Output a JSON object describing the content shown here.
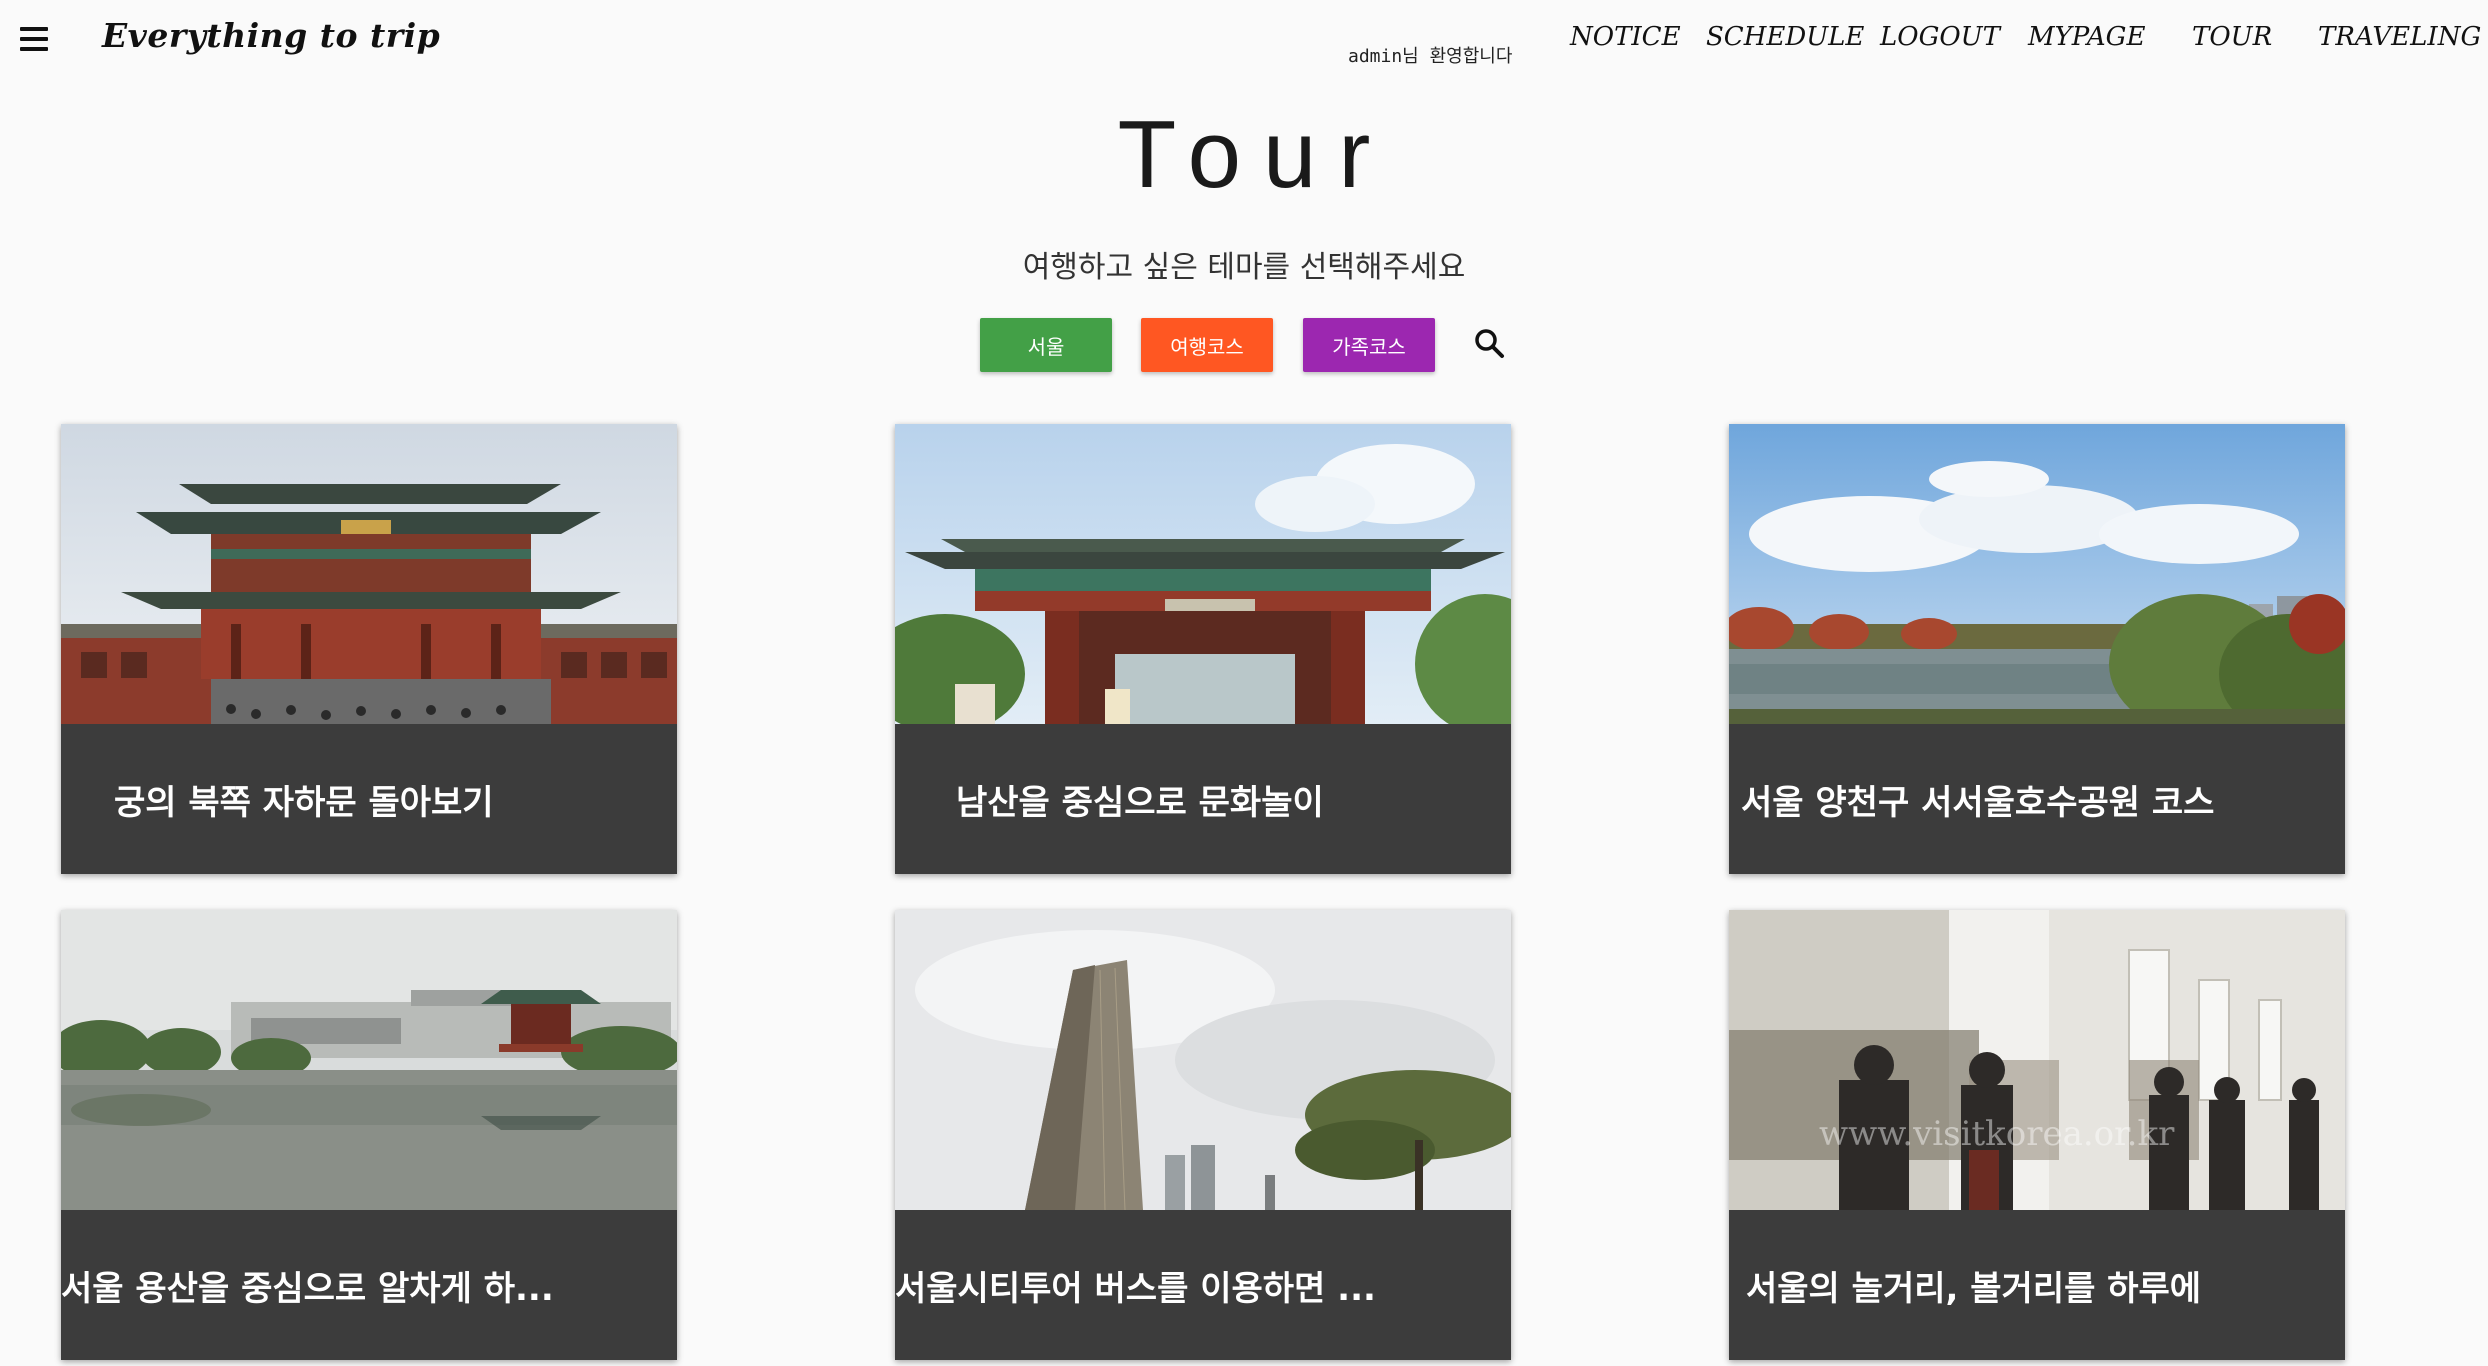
{
  "header": {
    "brand": "Everything to trip",
    "welcome": "admin님 환영합니다",
    "nav": [
      "NOTICE",
      "SCHEDULE",
      "LOGOUT",
      "MYPAGE",
      "TOUR",
      "TRAVELING"
    ]
  },
  "page": {
    "title": "Tour",
    "subtitle": "여행하고 싶은 테마를 선택해주세요"
  },
  "filters": [
    {
      "label": "서울",
      "color": "#43a047"
    },
    {
      "label": "여행코스",
      "color": "#ff5722"
    },
    {
      "label": "가족코스",
      "color": "#9c27b0"
    }
  ],
  "search": {
    "icon": "search-icon"
  },
  "cards": [
    {
      "title": "궁의 북쪽 자하문 돌아보기"
    },
    {
      "title": "남산을 중심으로 문화놀이"
    },
    {
      "title": "서울 양천구 서서울호수공원 코스"
    },
    {
      "title": "서울 용산을 중심으로 알차게 하..."
    },
    {
      "title": "서울시티투어 버스를 이용하면 ..."
    },
    {
      "title": "서울의 놀거리, 볼거리를 하루에"
    }
  ],
  "watermark": "www.visitkorea.or.kr",
  "colors": {
    "background": "#fafafa",
    "card_caption": "#3c3c3c"
  }
}
